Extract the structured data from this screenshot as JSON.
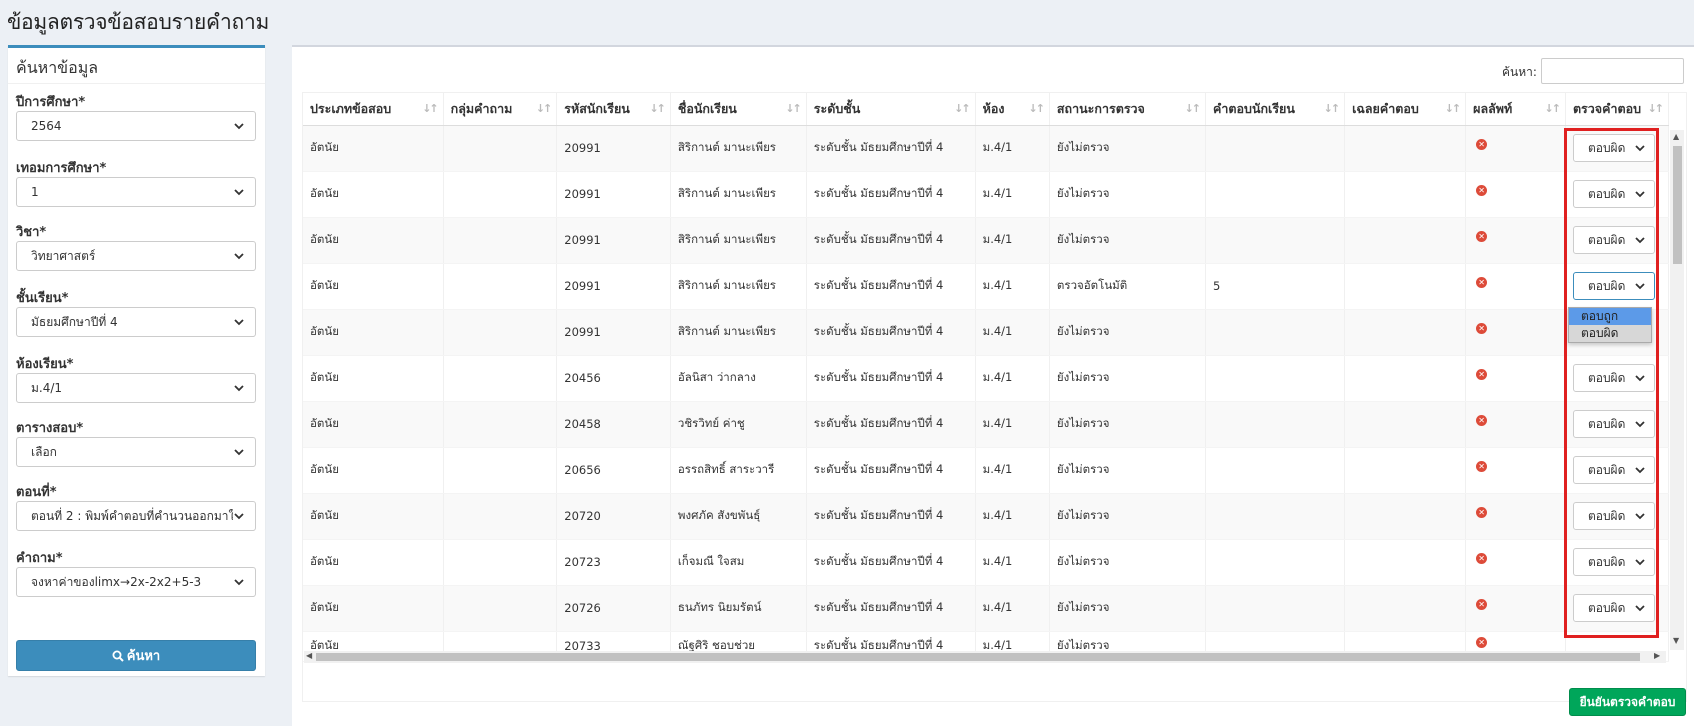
{
  "page": {
    "title": "ข้อมูลตรวจข้อสอบรายคำถาม"
  },
  "search_panel": {
    "header": "ค้นหาข้อมูล",
    "fields": [
      {
        "label": "ปีการศึกษา*",
        "value": "2564"
      },
      {
        "label": "เทอมการศึกษา*",
        "value": "1"
      },
      {
        "label": "วิชา*",
        "value": "วิทยาศาสตร์"
      },
      {
        "label": "ชั้นเรียน*",
        "value": "มัธยมศึกษาปีที่ 4"
      },
      {
        "label": "ห้องเรียน*",
        "value": "ม.4/1"
      },
      {
        "label": "ตารางสอบ*",
        "value": "เลือก"
      },
      {
        "label": "ตอนที่*",
        "value": "ตอนที่ 2 : พิมพ์คำตอบที่คำนวนออกมาใ"
      },
      {
        "label": "คำถาม*",
        "value": "จงหาค่าของlimx→2x-2x2+5-3"
      }
    ],
    "search_button": "ค้นหา",
    "search_icon": "search-icon"
  },
  "table": {
    "filter_label": "ค้นหา:",
    "columns": [
      "ประเภทข้อสอบ",
      "กลุ่มคำถาม",
      "รหัสนักเรียน",
      "ชื่อนักเรียน",
      "ระดับชั้น",
      "ห้อง",
      "สถานะการตรวจ",
      "คำตอบนักเรียน",
      "เฉลยคำตอบ",
      "ผลลัพท์",
      "ตรวจคำตอบ"
    ],
    "rows": [
      {
        "type": "อัตนัย",
        "group": "",
        "student_id": "20991",
        "name": "สิริกานต์ มานะเพียร",
        "level": "ระดับชั้น มัธยมศึกษาปีที่ 4",
        "room": "ม.4/1",
        "status": "ยังไม่ตรวจ",
        "answer": "",
        "key": "",
        "grade": "ตอบผิด"
      },
      {
        "type": "อัตนัย",
        "group": "",
        "student_id": "20991",
        "name": "สิริกานต์ มานะเพียร",
        "level": "ระดับชั้น มัธยมศึกษาปีที่ 4",
        "room": "ม.4/1",
        "status": "ยังไม่ตรวจ",
        "answer": "",
        "key": "",
        "grade": "ตอบผิด"
      },
      {
        "type": "อัตนัย",
        "group": "",
        "student_id": "20991",
        "name": "สิริกานต์ มานะเพียร",
        "level": "ระดับชั้น มัธยมศึกษาปีที่ 4",
        "room": "ม.4/1",
        "status": "ยังไม่ตรวจ",
        "answer": "",
        "key": "",
        "grade": "ตอบผิด"
      },
      {
        "type": "อัตนัย",
        "group": "",
        "student_id": "20991",
        "name": "สิริกานต์ มานะเพียร",
        "level": "ระดับชั้น มัธยมศึกษาปีที่ 4",
        "room": "ม.4/1",
        "status": "ตรวจอัตโนมัติ",
        "answer": "5",
        "key": "",
        "grade": "ตอบผิด"
      },
      {
        "type": "อัตนัย",
        "group": "",
        "student_id": "20991",
        "name": "สิริกานต์ มานะเพียร",
        "level": "ระดับชั้น มัธยมศึกษาปีที่ 4",
        "room": "ม.4/1",
        "status": "ยังไม่ตรวจ",
        "answer": "",
        "key": "",
        "grade": ""
      },
      {
        "type": "อัตนัย",
        "group": "",
        "student_id": "20456",
        "name": "อัลนิสา ว่ากลาง",
        "level": "ระดับชั้น มัธยมศึกษาปีที่ 4",
        "room": "ม.4/1",
        "status": "ยังไม่ตรวจ",
        "answer": "",
        "key": "",
        "grade": "ตอบผิด"
      },
      {
        "type": "อัตนัย",
        "group": "",
        "student_id": "20458",
        "name": "วชิรวิทย์ ค่าชู",
        "level": "ระดับชั้น มัธยมศึกษาปีที่ 4",
        "room": "ม.4/1",
        "status": "ยังไม่ตรวจ",
        "answer": "",
        "key": "",
        "grade": "ตอบผิด"
      },
      {
        "type": "อัตนัย",
        "group": "",
        "student_id": "20656",
        "name": "อรรถสิทธิ์ สาระวารี",
        "level": "ระดับชั้น มัธยมศึกษาปีที่ 4",
        "room": "ม.4/1",
        "status": "ยังไม่ตรวจ",
        "answer": "",
        "key": "",
        "grade": "ตอบผิด"
      },
      {
        "type": "อัตนัย",
        "group": "",
        "student_id": "20720",
        "name": "พงศภัค สังขพันธุ์",
        "level": "ระดับชั้น มัธยมศึกษาปีที่ 4",
        "room": "ม.4/1",
        "status": "ยังไม่ตรวจ",
        "answer": "",
        "key": "",
        "grade": "ตอบผิด"
      },
      {
        "type": "อัตนัย",
        "group": "",
        "student_id": "20723",
        "name": "เก็จมณี ใจสม",
        "level": "ระดับชั้น มัธยมศึกษาปีที่ 4",
        "room": "ม.4/1",
        "status": "ยังไม่ตรวจ",
        "answer": "",
        "key": "",
        "grade": "ตอบผิด"
      },
      {
        "type": "อัตนัย",
        "group": "",
        "student_id": "20726",
        "name": "ธนภัทร นิยมรัตน์",
        "level": "ระดับชั้น มัธยมศึกษาปีที่ 4",
        "room": "ม.4/1",
        "status": "ยังไม่ตรวจ",
        "answer": "",
        "key": "",
        "grade": "ตอบผิด"
      },
      {
        "type": "อัตนัย",
        "group": "",
        "student_id": "20733",
        "name": "ณัฐศิริ ชอบช่วย",
        "level": "ระดับชั้น มัธยมศึกษาปีที่ 4",
        "room": "ม.4/1",
        "status": "ยังไม่ตรวจ",
        "answer": "",
        "key": "",
        "grade": ""
      }
    ],
    "result_icon": "wrong-icon",
    "dropdown_options": [
      "ตอบถูก",
      "ตอบผิด"
    ]
  },
  "footer": {
    "confirm_button": "ยืนยันตรวจคำตอบ"
  },
  "colors": {
    "primary": "#3c8dbc",
    "success": "#00a65a",
    "danger": "#dd4b39",
    "highlight": "#e02020"
  }
}
